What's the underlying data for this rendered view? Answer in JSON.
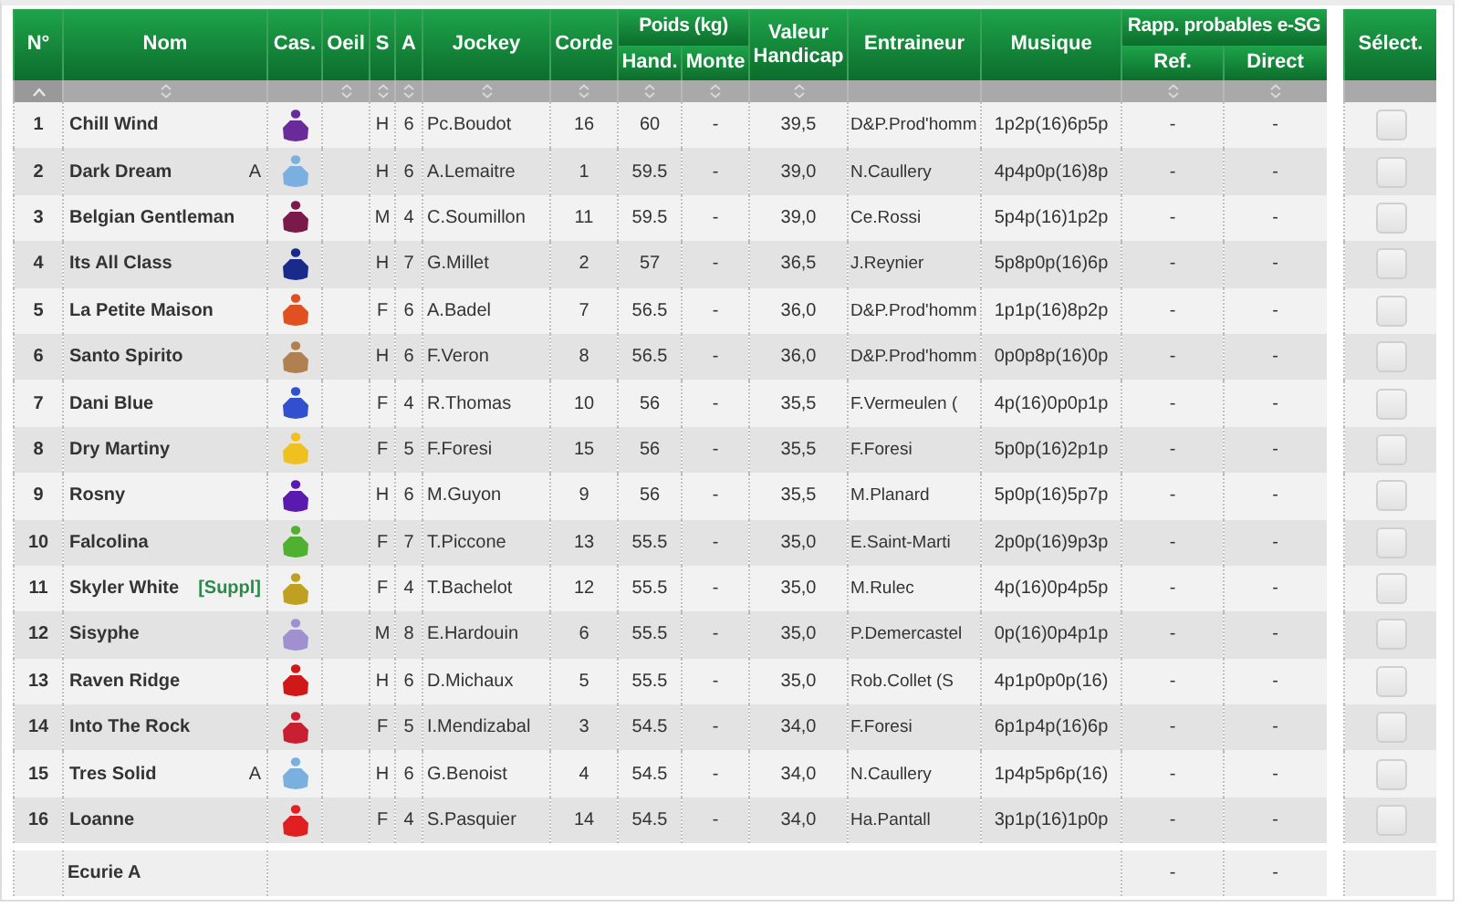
{
  "columns": [
    {
      "label": "N°",
      "sortable": true,
      "sorted": true
    },
    {
      "label": "Nom",
      "sortable": true,
      "sorted": false
    },
    {
      "label": "Cas.",
      "sortable": false,
      "sorted": false
    },
    {
      "label": "Oeil",
      "sortable": true,
      "sorted": false
    },
    {
      "label": "S",
      "sortable": true,
      "sorted": false
    },
    {
      "label": "A",
      "sortable": true,
      "sorted": false
    },
    {
      "label": "Jockey",
      "sortable": true,
      "sorted": false
    },
    {
      "label": "Corde",
      "sortable": true,
      "sorted": false
    },
    {
      "label": "Poids (kg)",
      "columns": [
        {
          "label": "Hand.",
          "sortable": true,
          "sorted": false
        },
        {
          "label": "Monte",
          "sortable": true,
          "sorted": false
        }
      ]
    },
    {
      "label": "Valeur Handicap",
      "sortable": true,
      "sorted": false
    },
    {
      "label": "Entraineur",
      "sortable": false,
      "sorted": false
    },
    {
      "label": "Musique",
      "sortable": false,
      "sorted": false
    },
    {
      "label": "Rapp. probables e-SG",
      "columns": [
        {
          "label": "Ref.",
          "sortable": true,
          "sorted": false
        },
        {
          "label": "Direct",
          "sortable": true,
          "sorted": false
        }
      ]
    }
  ],
  "select_header": "Sélect.",
  "rows": [
    {
      "num": "1",
      "name": "Chill Wind",
      "color": "#6a2a9a",
      "sex": "H",
      "age": "6",
      "jockey": "Pc.Boudot",
      "corde": "16",
      "hand": "60",
      "monte": "-",
      "valeur": "39,5",
      "trainer": "D&P.Prod'homm",
      "musique": "1p2p(16)6p5p",
      "ref": "-",
      "direct": "-",
      "checked": false
    },
    {
      "num": "2",
      "name": "Dark Dream",
      "tag": {
        "text": "A",
        "kind": "stable"
      },
      "color": "#7ab0e0",
      "sex": "H",
      "age": "6",
      "jockey": "A.Lemaitre",
      "corde": "1",
      "hand": "59.5",
      "monte": "-",
      "valeur": "39,0",
      "trainer": "N.Caullery",
      "musique": "4p4p0p(16)8p",
      "ref": "-",
      "direct": "-",
      "checked": false
    },
    {
      "num": "3",
      "name": "Belgian Gentleman",
      "color": "#7a1a4a",
      "sex": "M",
      "age": "4",
      "jockey": "C.Soumillon",
      "corde": "11",
      "hand": "59.5",
      "monte": "-",
      "valeur": "39,0",
      "trainer": "Ce.Rossi",
      "musique": "5p4p(16)1p2p",
      "ref": "-",
      "direct": "-",
      "checked": false
    },
    {
      "num": "4",
      "name": "Its All Class",
      "color": "#1a2a8a",
      "sex": "H",
      "age": "7",
      "jockey": "G.Millet",
      "corde": "2",
      "hand": "57",
      "monte": "-",
      "valeur": "36,5",
      "trainer": "J.Reynier",
      "musique": "5p8p0p(16)6p",
      "ref": "-",
      "direct": "-",
      "checked": false
    },
    {
      "num": "5",
      "name": "La Petite Maison",
      "color": "#e05020",
      "sex": "F",
      "age": "6",
      "jockey": "A.Badel",
      "corde": "7",
      "hand": "56.5",
      "monte": "-",
      "valeur": "36,0",
      "trainer": "D&P.Prod'homm",
      "musique": "1p1p(16)8p2p",
      "ref": "-",
      "direct": "-",
      "checked": false
    },
    {
      "num": "6",
      "name": "Santo Spirito",
      "color": "#b08050",
      "sex": "H",
      "age": "6",
      "jockey": "F.Veron",
      "corde": "8",
      "hand": "56.5",
      "monte": "-",
      "valeur": "36,0",
      "trainer": "D&P.Prod'homm",
      "musique": "0p0p8p(16)0p",
      "ref": "-",
      "direct": "-",
      "checked": false
    },
    {
      "num": "7",
      "name": "Dani Blue",
      "color": "#3050d0",
      "sex": "F",
      "age": "4",
      "jockey": "R.Thomas",
      "corde": "10",
      "hand": "56",
      "monte": "-",
      "valeur": "35,5",
      "trainer": "F.Vermeulen (",
      "musique": "4p(16)0p0p1p",
      "ref": "-",
      "direct": "-",
      "checked": false
    },
    {
      "num": "8",
      "name": "Dry Martiny",
      "color": "#f0c020",
      "sex": "F",
      "age": "5",
      "jockey": "F.Foresi",
      "corde": "15",
      "hand": "56",
      "monte": "-",
      "valeur": "35,5",
      "trainer": "F.Foresi",
      "musique": "5p0p(16)2p1p",
      "ref": "-",
      "direct": "-",
      "checked": false
    },
    {
      "num": "9",
      "name": "Rosny",
      "color": "#5a1ab0",
      "sex": "H",
      "age": "6",
      "jockey": "M.Guyon",
      "corde": "9",
      "hand": "56",
      "monte": "-",
      "valeur": "35,5",
      "trainer": "M.Planard",
      "musique": "5p0p(16)5p7p",
      "ref": "-",
      "direct": "-",
      "checked": false
    },
    {
      "num": "10",
      "name": "Falcolina",
      "color": "#50b030",
      "sex": "F",
      "age": "7",
      "jockey": "T.Piccone",
      "corde": "13",
      "hand": "55.5",
      "monte": "-",
      "valeur": "35,0",
      "trainer": "E.Saint-Marti",
      "musique": "2p0p(16)9p3p",
      "ref": "-",
      "direct": "-",
      "checked": false
    },
    {
      "num": "11",
      "name": "Skyler White",
      "tag": {
        "text": "[Suppl]",
        "kind": "supplement"
      },
      "color": "#c0a020",
      "sex": "F",
      "age": "4",
      "jockey": "T.Bachelot",
      "corde": "12",
      "hand": "55.5",
      "monte": "-",
      "valeur": "35,0",
      "trainer": "M.Rulec",
      "musique": "4p(16)0p4p5p",
      "ref": "-",
      "direct": "-",
      "checked": false
    },
    {
      "num": "12",
      "name": "Sisyphe",
      "color": "#a090d0",
      "sex": "M",
      "age": "8",
      "jockey": "E.Hardouin",
      "corde": "6",
      "hand": "55.5",
      "monte": "-",
      "valeur": "35,0",
      "trainer": "P.Demercastel",
      "musique": "0p(16)0p4p1p",
      "ref": "-",
      "direct": "-",
      "checked": false
    },
    {
      "num": "13",
      "name": "Raven Ridge",
      "color": "#d01818",
      "sex": "H",
      "age": "6",
      "jockey": "D.Michaux",
      "corde": "5",
      "hand": "55.5",
      "monte": "-",
      "valeur": "35,0",
      "trainer": "Rob.Collet (S",
      "musique": "4p1p0p0p(16)",
      "ref": "-",
      "direct": "-",
      "checked": false
    },
    {
      "num": "14",
      "name": "Into The Rock",
      "color": "#c82030",
      "sex": "F",
      "age": "5",
      "jockey": "I.Mendizabal",
      "corde": "3",
      "hand": "54.5",
      "monte": "-",
      "valeur": "34,0",
      "trainer": "F.Foresi",
      "musique": "6p1p4p(16)6p",
      "ref": "-",
      "direct": "-",
      "checked": false
    },
    {
      "num": "15",
      "name": "Tres Solid",
      "tag": {
        "text": "A",
        "kind": "stable"
      },
      "color": "#7ab0e0",
      "sex": "H",
      "age": "6",
      "jockey": "G.Benoist",
      "corde": "4",
      "hand": "54.5",
      "monte": "-",
      "valeur": "34,0",
      "trainer": "N.Caullery",
      "musique": "1p4p5p6p(16)",
      "ref": "-",
      "direct": "-",
      "checked": false
    },
    {
      "num": "16",
      "name": "Loanne",
      "color": "#e02020",
      "sex": "F",
      "age": "4",
      "jockey": "S.Pasquier",
      "corde": "14",
      "hand": "54.5",
      "monte": "-",
      "valeur": "34,0",
      "trainer": "Ha.Pantall",
      "musique": "3p1p(16)1p0p",
      "ref": "-",
      "direct": "-",
      "checked": false
    }
  ],
  "footer": {
    "label": "Ecurie A",
    "ref": "-",
    "direct": "-"
  }
}
